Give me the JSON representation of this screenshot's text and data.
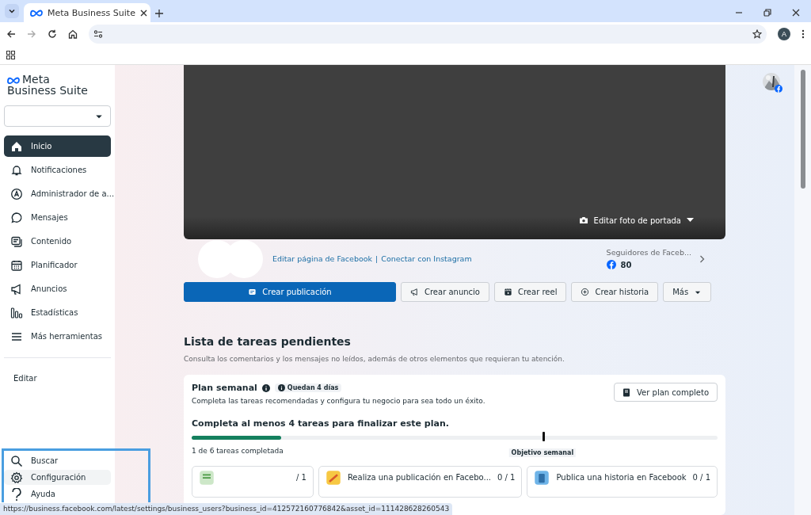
{
  "browser": {
    "tab_title": "Meta Business Suite",
    "profile_initial": "A"
  },
  "sidebar": {
    "logo_line1": "Meta",
    "logo_line2": "Business Suite",
    "items": [
      {
        "label": "Inicio",
        "kind": "home",
        "selected": true
      },
      {
        "label": "Notificaciones",
        "kind": "bell",
        "selected": false
      },
      {
        "label": "Administrador de a...",
        "kind": "compass",
        "selected": false
      },
      {
        "label": "Mensajes",
        "kind": "chat",
        "selected": false
      },
      {
        "label": "Contenido",
        "kind": "content",
        "selected": false
      },
      {
        "label": "Planificador",
        "kind": "calendar",
        "selected": false
      },
      {
        "label": "Anuncios",
        "kind": "megaphone",
        "selected": false
      },
      {
        "label": "Estadísticas",
        "kind": "bars",
        "selected": false
      },
      {
        "label": "Más herramientas",
        "kind": "menu",
        "selected": false
      }
    ],
    "edit": "Editar",
    "bottom_items": [
      {
        "label": "Buscar",
        "kind": "search",
        "hovered": false
      },
      {
        "label": "Configuración",
        "kind": "gear",
        "hovered": true
      },
      {
        "label": "Ayuda",
        "kind": "help",
        "hovered": false
      }
    ]
  },
  "cover": {
    "edit_label": "Editar foto de portada"
  },
  "page": {
    "edit_link": "Editar página de Facebook",
    "separator": "|",
    "instagram_link": "Conectar con Instagram",
    "followers_label": "Seguidores de Faceb...",
    "followers_count": "80"
  },
  "actions": [
    {
      "label": "Crear publicación",
      "kind": "post",
      "primary": true
    },
    {
      "label": "Crear anuncio",
      "kind": "megaphone",
      "primary": false
    },
    {
      "label": "Crear reel",
      "kind": "reel",
      "primary": false
    },
    {
      "label": "Crear historia",
      "kind": "plus-circle",
      "primary": false
    },
    {
      "label": "Más",
      "kind": "caret",
      "primary": false
    }
  ],
  "todo": {
    "title": "Lista de tareas pendientes",
    "subtitle": "Consulta los comentarios y los mensajes no leídos, además de otros elementos que requieran tu atención.",
    "plan": {
      "title": "Plan semanal",
      "badge": "Quedan 4 días",
      "description": "Completa las tareas recomendadas y configura tu negocio para sea todo un éxito.",
      "button": "Ver plan completo",
      "goal_text": "Completa al menos 4 tareas para finalizar este plan.",
      "level": 0.17,
      "progress_text": "1 de 6 tareas completada",
      "goal_label": "Objetivo semanal"
    },
    "tasks": [
      {
        "count": "/ 1",
        "kind": "doc"
      },
      {
        "title": "Realiza una publicación en Facebo...",
        "count": "0 / 1",
        "kind": "pencil"
      },
      {
        "title": "Publica una historia en Facebook",
        "count": "0 / 1",
        "kind": "book"
      }
    ]
  },
  "status_url": "https://business.facebook.com/latest/settings/business_users?business_id=412572160776842&asset_id=111428628260543"
}
